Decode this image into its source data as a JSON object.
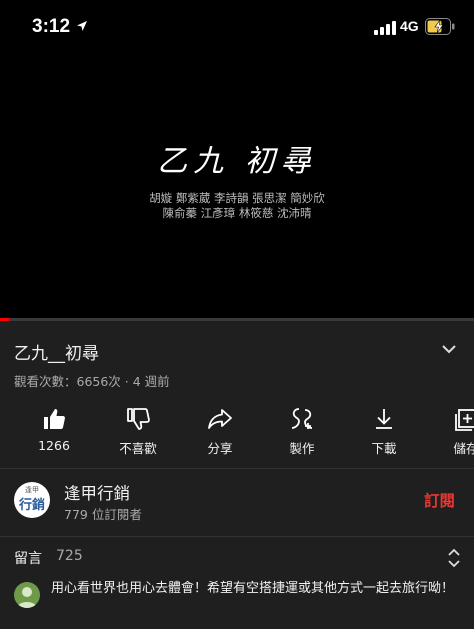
{
  "status_bar": {
    "time": "3:12",
    "network": "4G"
  },
  "video": {
    "title": "乙九 初尋",
    "credits_line1": "胡嫙 鄭紫葳 李詩韻 張思潔 簡妙欣",
    "credits_line2": "陳俞蓁 江彥璋 林筱慈 沈沛晴",
    "progress": 0.02,
    "progress_color": "#ff0000"
  },
  "info": {
    "title": "乙九__初尋",
    "meta": "觀看次數：6656次 · 4 週前"
  },
  "actions": [
    {
      "icon": "thumbs-up-icon",
      "label": "1266"
    },
    {
      "icon": "thumbs-down-icon",
      "label": "不喜歡"
    },
    {
      "icon": "share-icon",
      "label": "分享"
    },
    {
      "icon": "remix-icon",
      "label": "製作"
    },
    {
      "icon": "download-icon",
      "label": "下載"
    },
    {
      "icon": "save-icon",
      "label": "儲存"
    }
  ],
  "channel": {
    "avatar_top": "逢甲",
    "avatar_main": "行銷",
    "name": "逢甲行銷",
    "subscribers": "779 位訂閱者",
    "subscribe_label": "訂閱",
    "subscribe_color": "#e53935"
  },
  "comments": {
    "label": "留言",
    "count": "725",
    "first_comment": "用心看世界也用心去體會！希望有空搭捷運或其他方式一起去旅行呦！"
  }
}
